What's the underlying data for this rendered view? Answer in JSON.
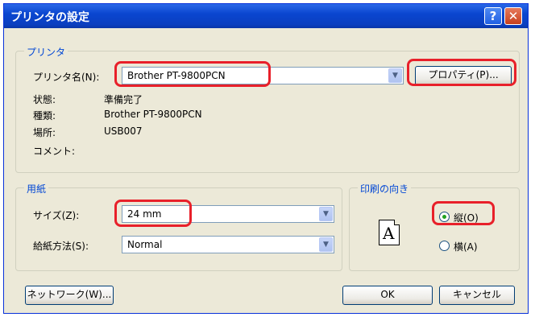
{
  "window": {
    "title": "プリンタの設定",
    "help_symbol": "?",
    "close_symbol": "✕"
  },
  "printer_group": {
    "legend": "プリンタ",
    "name_label": "プリンタ名(N):",
    "name_value": "Brother PT-9800PCN",
    "properties_button": "プロパティ(P)...",
    "status_label": "状態:",
    "status_value": "準備完了",
    "type_label": "種類:",
    "type_value": "Brother PT-9800PCN",
    "location_label": "場所:",
    "location_value": "USB007",
    "comment_label": "コメント:"
  },
  "paper_group": {
    "legend": "用紙",
    "size_label": "サイズ(Z):",
    "size_value": "24 mm",
    "feed_label": "給紙方法(S):",
    "feed_value": "Normal"
  },
  "orientation_group": {
    "legend": "印刷の向き",
    "icon_letter": "A",
    "portrait_label": "縦(O)",
    "landscape_label": "横(A)",
    "selected": "portrait"
  },
  "buttons": {
    "network": "ネットワーク(W)...",
    "ok": "OK",
    "cancel": "キャンセル"
  },
  "colors": {
    "title_bar": "#0a46d0",
    "highlight": "#e8202a",
    "group_legend": "#0046d5",
    "dialog_bg": "#ece9d8"
  }
}
